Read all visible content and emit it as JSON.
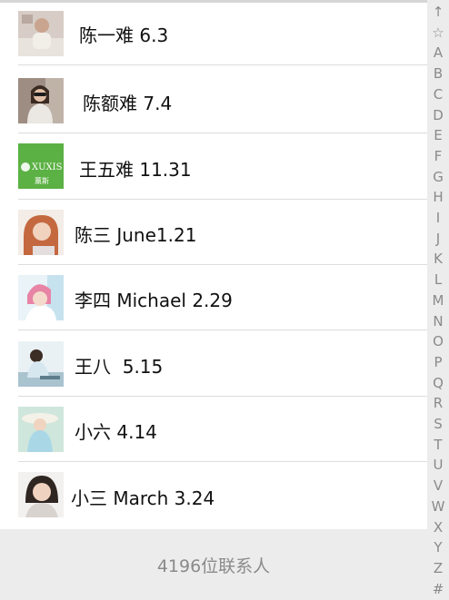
{
  "contacts": [
    {
      "name": "陈一难 6.3",
      "avatar": "person-photo-avatar"
    },
    {
      "name": "陈额难 7.4",
      "avatar": "woman-sunglasses-avatar"
    },
    {
      "name": "王五难 11.31",
      "avatar": "green-logo-avatar",
      "avatar_text": "XUXIS",
      "avatar_text2": "薰斯"
    },
    {
      "name": "陈三 June1.21",
      "avatar": "redhead-girl-avatar"
    },
    {
      "name": "李四 Michael 2.29",
      "avatar": "girl-pink-avatar"
    },
    {
      "name": "王八  5.15",
      "avatar": "girl-sitting-avatar"
    },
    {
      "name": "小六 4.14",
      "avatar": "girl-hat-avatar"
    },
    {
      "name": "小三 March 3.24",
      "avatar": "girl-portrait-avatar"
    }
  ],
  "footer": {
    "count_text": "4196位联系人"
  },
  "index": [
    "↑",
    "☆",
    "A",
    "B",
    "C",
    "D",
    "E",
    "F",
    "G",
    "H",
    "I",
    "J",
    "K",
    "L",
    "M",
    "N",
    "O",
    "P",
    "Q",
    "R",
    "S",
    "T",
    "U",
    "V",
    "W",
    "X",
    "Y",
    "Z",
    "#"
  ],
  "colors": {
    "footer_bg": "#ececec",
    "index_text": "#8a8a8a",
    "separator": "#dcdcdc",
    "logo_green": "#5bb144"
  }
}
